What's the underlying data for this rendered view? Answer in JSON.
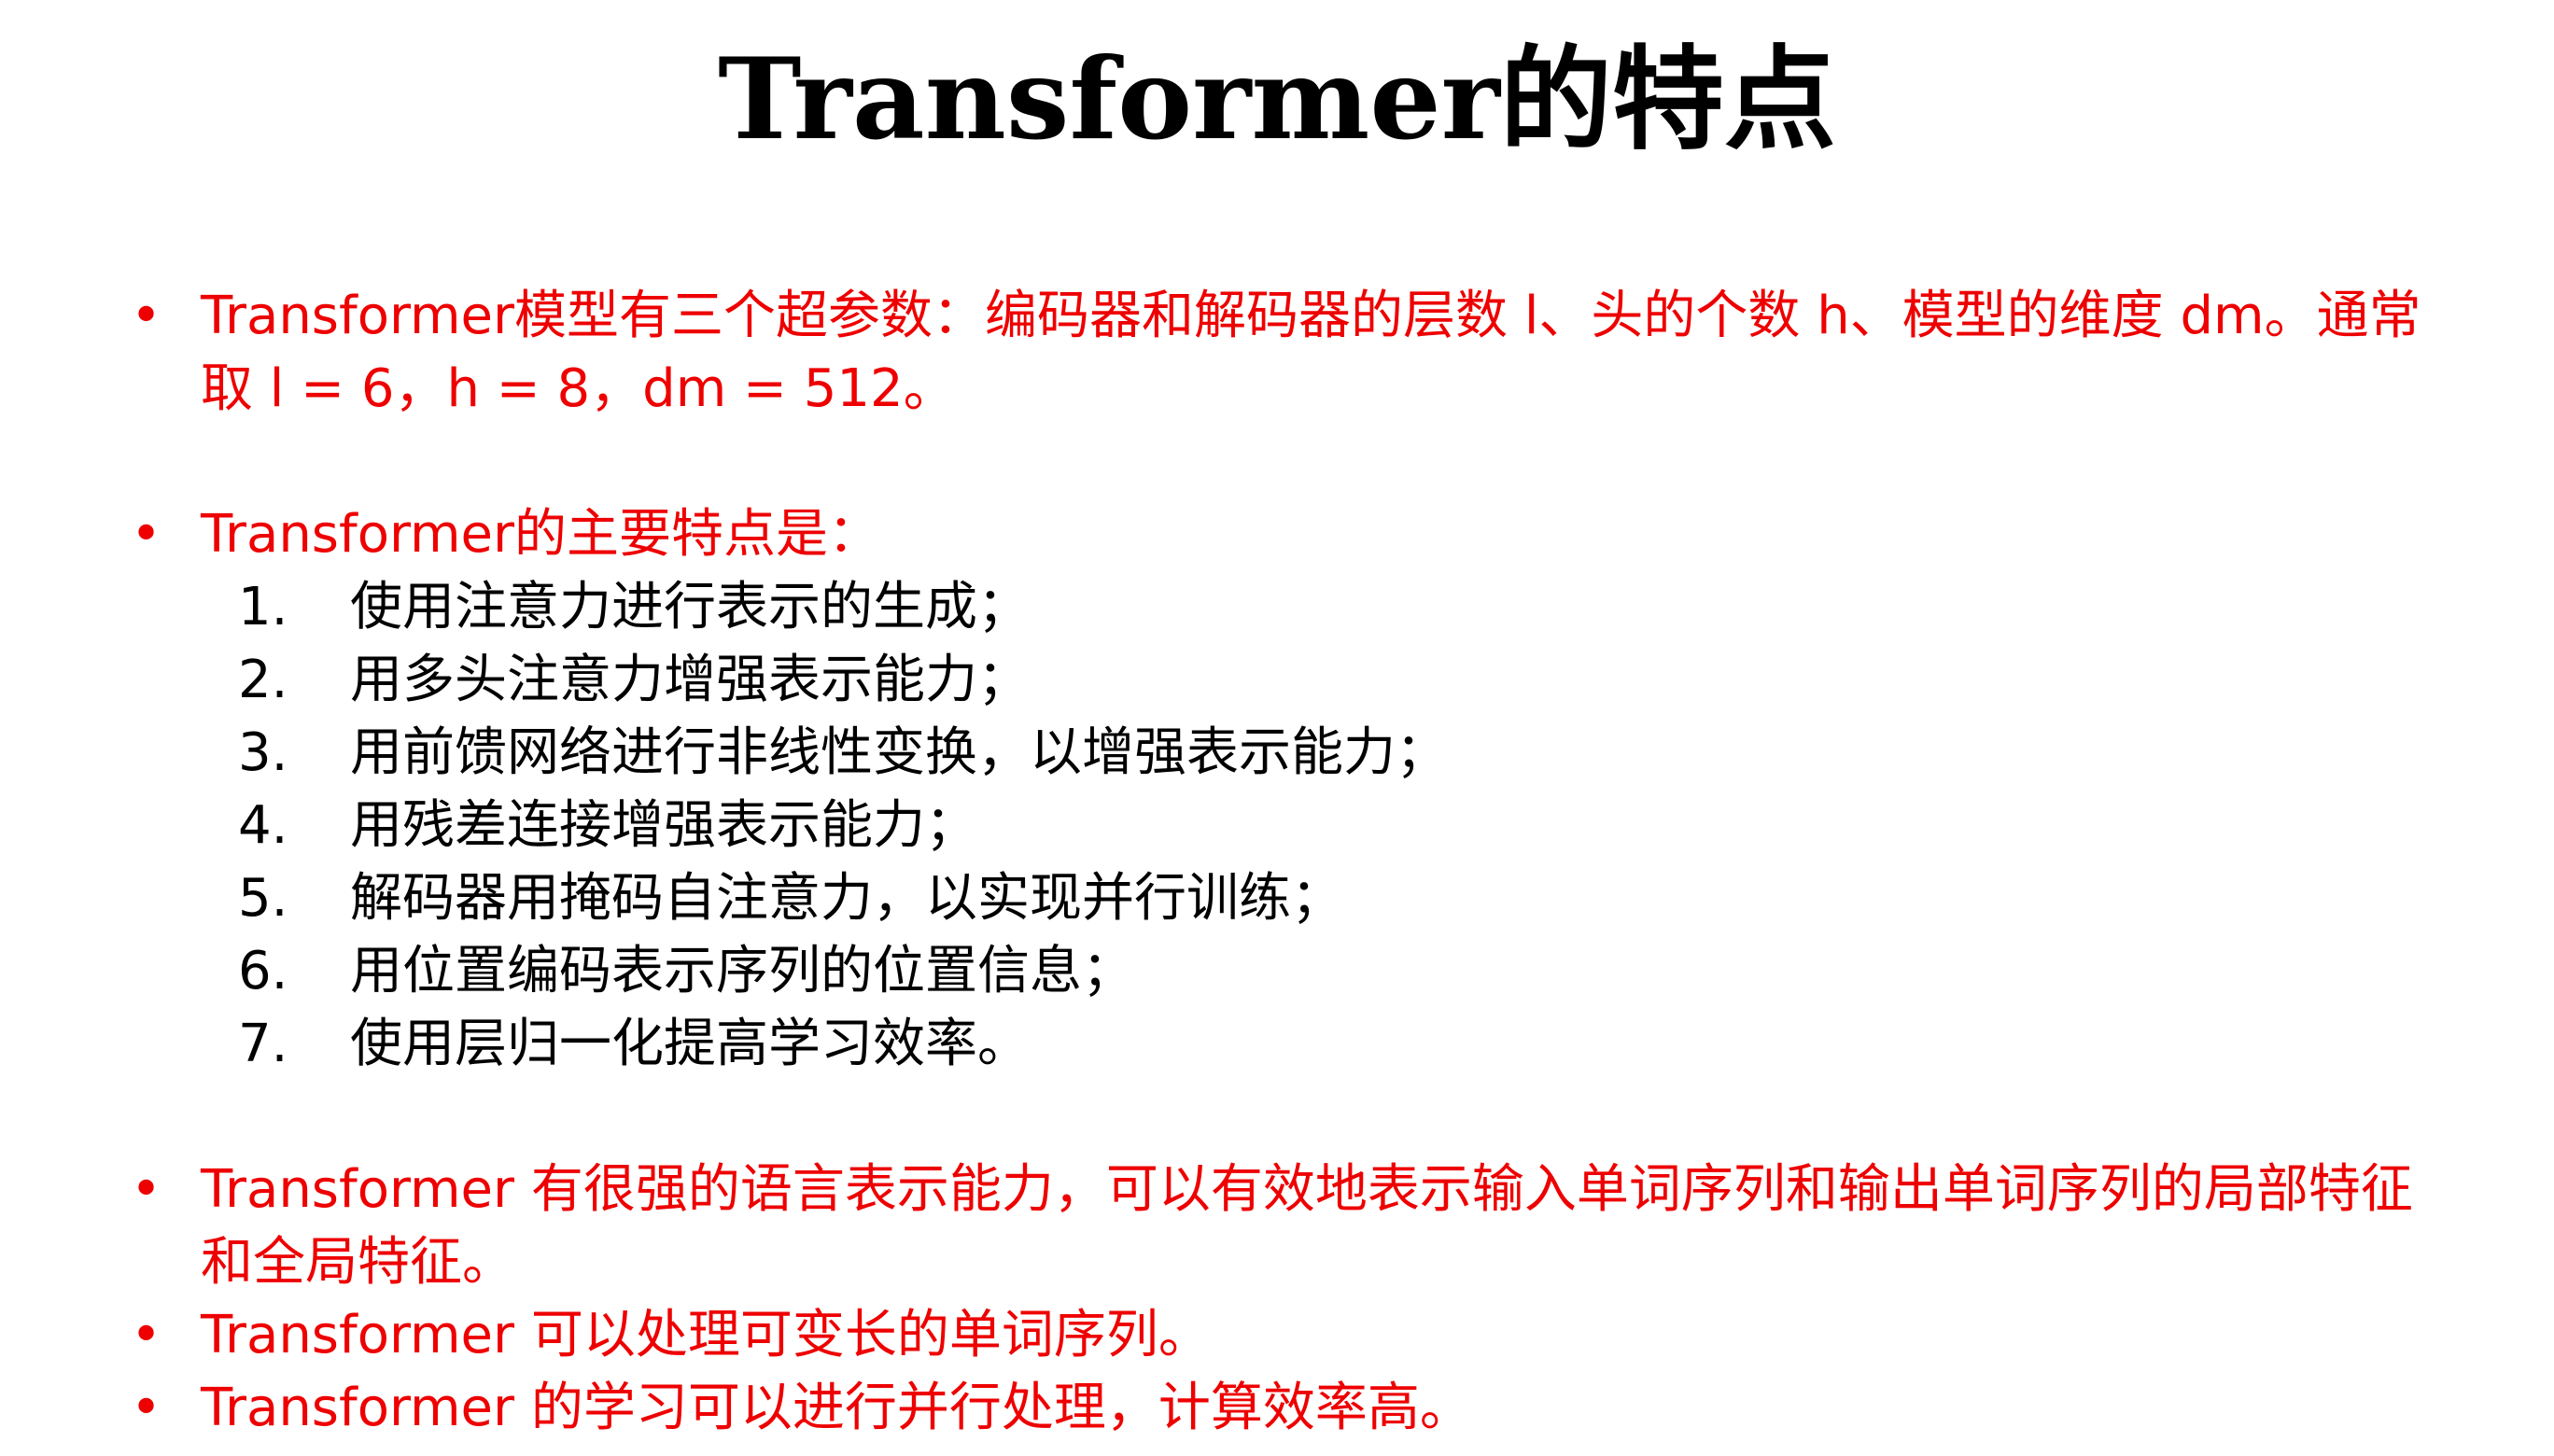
{
  "slide": {
    "title": "Transformer的特点",
    "bullet_symbol": "•",
    "colors": {
      "accent_red": "#ee0000",
      "text_black": "#000000",
      "background": "#ffffff"
    },
    "bullets": [
      {
        "text": "Transformer模型有三个超参数：编码器和解码器的层数 l、头的个数 h、模型的维度 dm。通常取 l = 6，h = 8，dm = 512。"
      },
      {
        "text": "Transformer的主要特点是："
      },
      {
        "text": "Transformer 有很强的语言表示能力，可以有效地表示输入单词序列和输出单词序列的局部特征和全局特征。"
      },
      {
        "text": "Transformer 可以处理可变长的单词序列。"
      },
      {
        "text": "Transformer 的学习可以进行并行处理，计算效率高。"
      }
    ],
    "features": [
      {
        "num": "1.",
        "text": "使用注意力进行表示的生成；"
      },
      {
        "num": "2.",
        "text": "用多头注意力增强表示能力；"
      },
      {
        "num": "3.",
        "text": "用前馈网络进行非线性变换，以增强表示能力；"
      },
      {
        "num": "4.",
        "text": "用残差连接增强表示能力；"
      },
      {
        "num": "5.",
        "text": "解码器用掩码自注意力，以实现并行训练；"
      },
      {
        "num": "6.",
        "text": "用位置编码表示序列的位置信息；"
      },
      {
        "num": "7.",
        "text": "使用层归一化提高学习效率。"
      }
    ]
  }
}
